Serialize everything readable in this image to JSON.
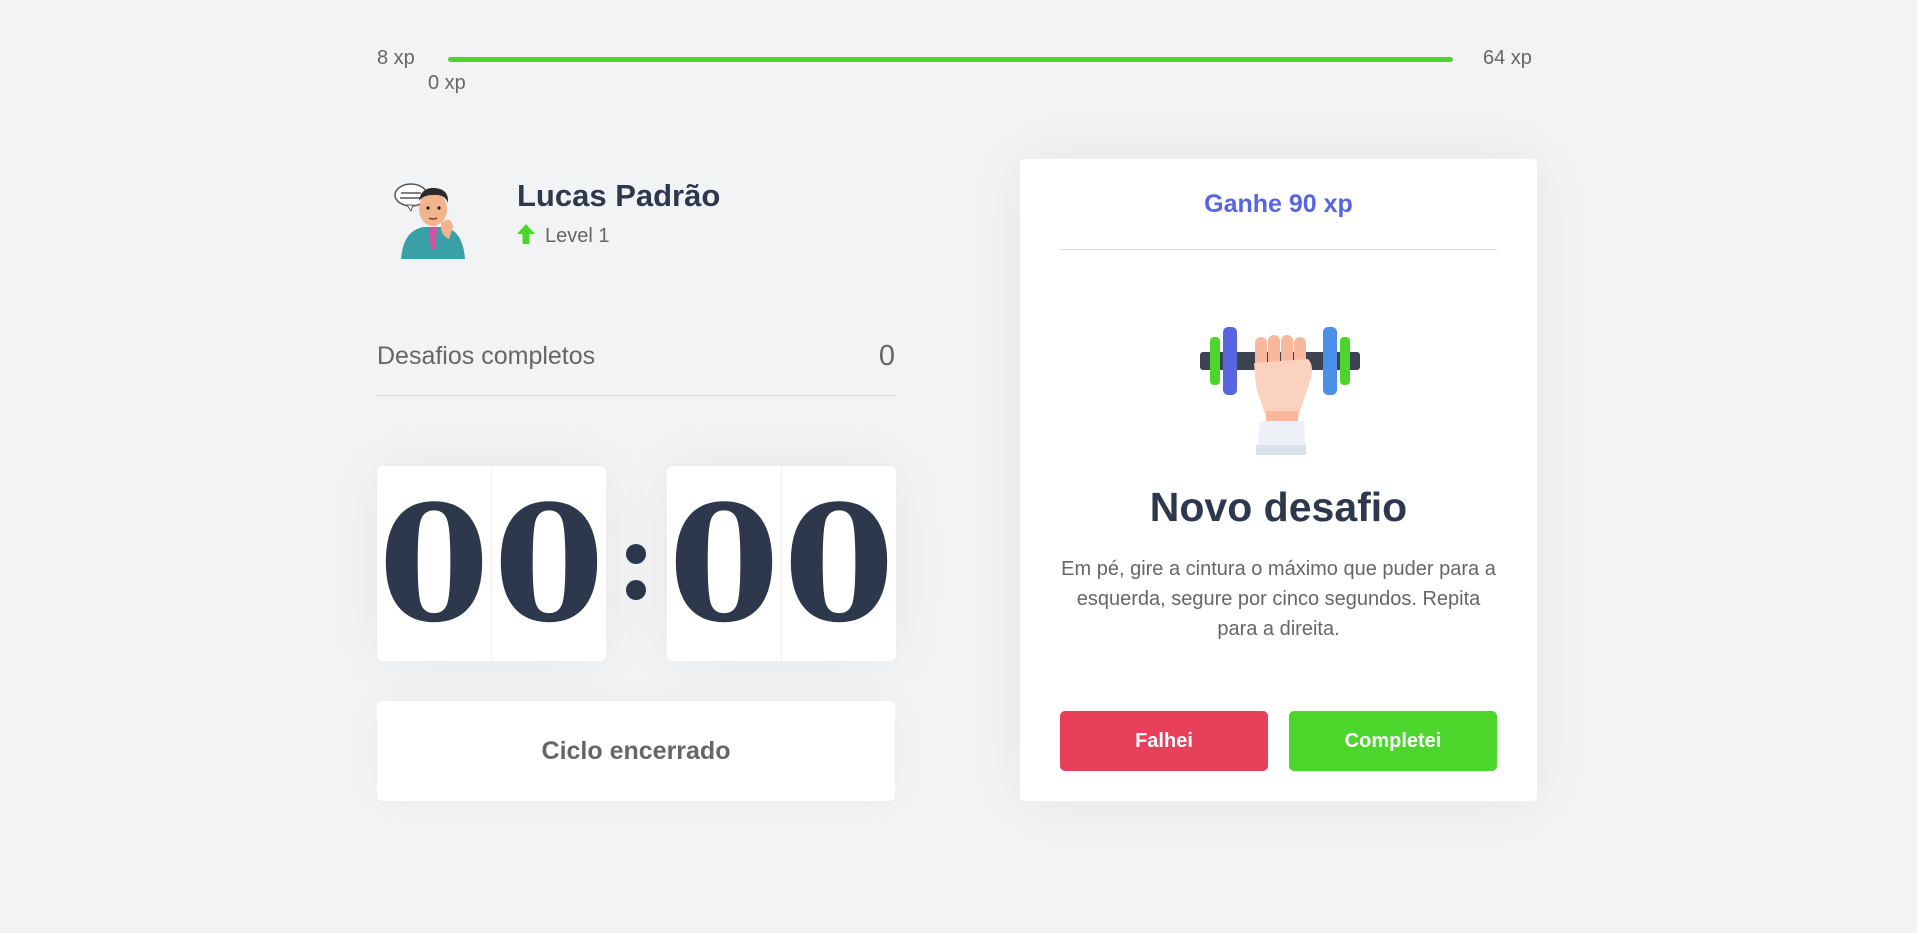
{
  "experience": {
    "min_label": "8 xp",
    "max_label": "64 xp",
    "current_label": "0 xp",
    "progress_fraction": 1.0,
    "bar_color": "#4cd62b"
  },
  "profile": {
    "avatar_icon": "avatar-illustration",
    "name": "Lucas Padrão",
    "level_icon": "level-up-arrow-icon",
    "level": "Level 1"
  },
  "stats": {
    "completed_label": "Desafios completos",
    "completed_value": "0"
  },
  "countdown": {
    "minute_left": "0",
    "minute_right": "0",
    "second_left": "0",
    "second_right": "0"
  },
  "cycle_button_label": "Ciclo encerrado",
  "challenge": {
    "header": "Ganhe 90 xp",
    "illustration_icon": "dumbbell-body-icon",
    "title": "Novo desafio",
    "description": "Em pé, gire a cintura o máximo que puder para a esquerda, segure por cinco segundos. Repita para a direita.",
    "fail_label": "Falhei",
    "success_label": "Completei"
  },
  "colors": {
    "accent": "#5965e0",
    "success": "#4cd62b",
    "danger": "#e83f5b",
    "title": "#2e384d",
    "text": "#666666",
    "background": "#f2f3f5"
  }
}
